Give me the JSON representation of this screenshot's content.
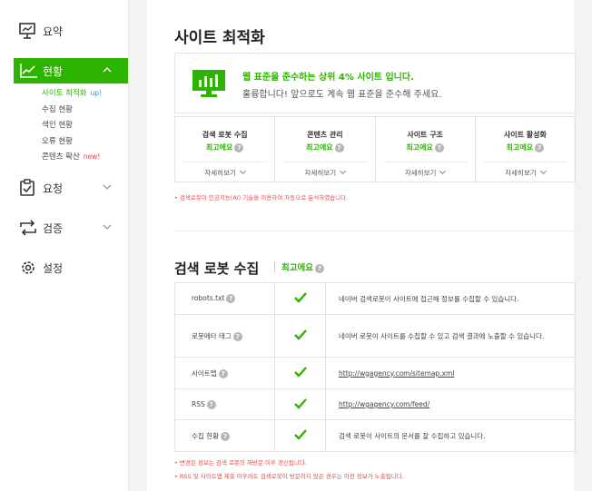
{
  "sidebar": {
    "summary_label": "요약",
    "status_label": "현황",
    "sub_items": [
      {
        "label": "사이트 최적화",
        "badge": "up!"
      },
      {
        "label": "수집 현황",
        "badge": ""
      },
      {
        "label": "색인 현황",
        "badge": ""
      },
      {
        "label": "오류 현황",
        "badge": ""
      },
      {
        "label": "콘텐츠 확산",
        "badge": "new!"
      }
    ],
    "request_label": "요청",
    "verify_label": "검증",
    "settings_label": "설정"
  },
  "optimization": {
    "title": "사이트 최적화",
    "banner_headline": "웹 표준을 준수하는 상위 4% 사이트 입니다.",
    "banner_sub": "훌륭합니다! 앞으로도 계속 웹 표준을 준수해 주세요.",
    "cards": [
      {
        "title": "검색 로봇 수집",
        "status": "최고에요",
        "more": "자세히보기"
      },
      {
        "title": "콘텐츠 관리",
        "status": "최고에요",
        "more": "자세히보기"
      },
      {
        "title": "사이트 구조",
        "status": "최고에요",
        "more": "자세히보기"
      },
      {
        "title": "사이트 활성화",
        "status": "최고에요",
        "more": "자세히보기"
      }
    ],
    "note": "• 검색로봇이 인공지능(AI) 기술을 이용하여 자동으로 분석하였습니다."
  },
  "crawl": {
    "title": "검색 로봇 수집",
    "status": "최고에요",
    "rows": [
      {
        "key": "robots.txt",
        "value": "네이버 검색로봇이 사이트에 접근해 정보를 수집할 수 있습니다.",
        "is_link": false
      },
      {
        "key": "로봇메타 태그",
        "value": "네이버 로봇이 사이트를 수집할 수 있고 검색 결과에 노출할 수 있습니다.",
        "is_link": false
      },
      {
        "key": "사이트맵",
        "value": "http://wgagency.com/sitemap.xml",
        "is_link": true
      },
      {
        "key": "RSS",
        "value": "http://wgagency.com/feed/",
        "is_link": true
      },
      {
        "key": "수집 현황",
        "value": "검색 로봇이 사이트의 문서를 잘 수집하고 있습니다.",
        "is_link": false
      }
    ],
    "note1": "• 변경된 정보는 검색 로봇의 재방문 이후 갱신됩니다.",
    "note2": "• RSS 및 사이트맵 제출 이후라도 검색로봇이 방문하지 않은 경우는 이전 정보가 노출됩니다."
  },
  "colors": {
    "accent": "#2db400",
    "alert": "#e84a4a",
    "badge_up": "#3a8ed4"
  }
}
